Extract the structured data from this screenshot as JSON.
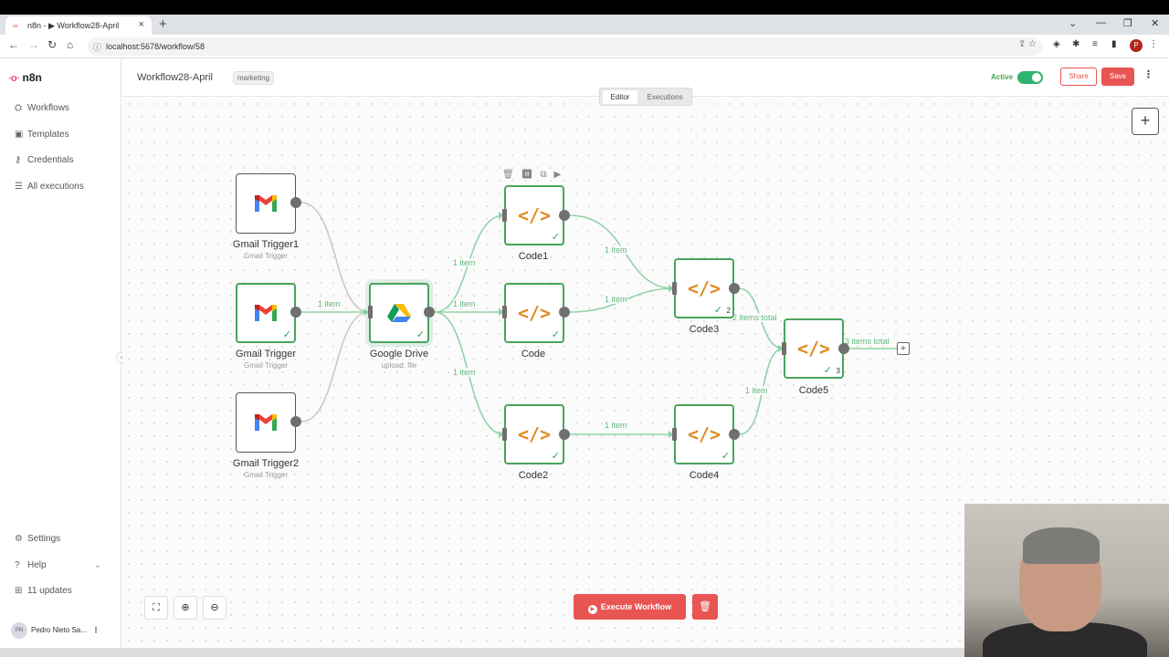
{
  "browser": {
    "tab_title": "n8n - ▶ Workflow28-April",
    "url": "localhost:5678/workflow/58",
    "profile_initial": "P"
  },
  "sidebar": {
    "logo": "n8n",
    "items": [
      {
        "label": "Workflows",
        "icon": "network-icon"
      },
      {
        "label": "Templates",
        "icon": "box-icon"
      },
      {
        "label": "Credentials",
        "icon": "key-icon"
      },
      {
        "label": "All executions",
        "icon": "list-icon"
      }
    ],
    "bottom_items": [
      {
        "label": "Settings",
        "icon": "gear-icon"
      },
      {
        "label": "Help",
        "icon": "question-icon"
      },
      {
        "label": "11 updates",
        "icon": "gift-icon"
      }
    ],
    "user": {
      "initials": "PN",
      "name": "Pedro Nieto Sa..."
    }
  },
  "header": {
    "workflow_name": "Workflow28-April",
    "tag": "marketing",
    "active_label": "Active",
    "active": true,
    "share_label": "Share",
    "save_label": "Save"
  },
  "mode_toggle": {
    "editor": "Editor",
    "executions": "Executions",
    "selected": "Editor"
  },
  "nodes": {
    "gmail_trigger1": {
      "name": "Gmail Trigger1",
      "sub": "Gmail Trigger"
    },
    "gmail_trigger": {
      "name": "Gmail Trigger",
      "sub": "Gmail Trigger"
    },
    "gmail_trigger2": {
      "name": "Gmail Trigger2",
      "sub": "Gmail Trigger"
    },
    "google_drive": {
      "name": "Google Drive",
      "sub": "upload: file"
    },
    "code1": {
      "name": "Code1"
    },
    "code": {
      "name": "Code"
    },
    "code2": {
      "name": "Code2"
    },
    "code3": {
      "name": "Code3",
      "count": "2"
    },
    "code4": {
      "name": "Code4"
    },
    "code5": {
      "name": "Code5",
      "count": "3"
    }
  },
  "edge_labels": {
    "gmail_to_drive": "1 item",
    "drive_to_code1": "1 item",
    "drive_to_code": "1 item",
    "drive_to_code2": "1 item",
    "code1_to_code3": "1 item",
    "code_to_code3": "1 item",
    "code3_to_code5": "2 items total",
    "code2_to_code4": "1 item",
    "code4_to_code5": "1 item",
    "code5_out": "3 items total"
  },
  "footer": {
    "execute_label": "Execute Workflow"
  },
  "colors": {
    "accent": "#e85552",
    "success": "#49a45b",
    "edge": "#8fd3a6",
    "code_icon": "#e08b1f"
  }
}
